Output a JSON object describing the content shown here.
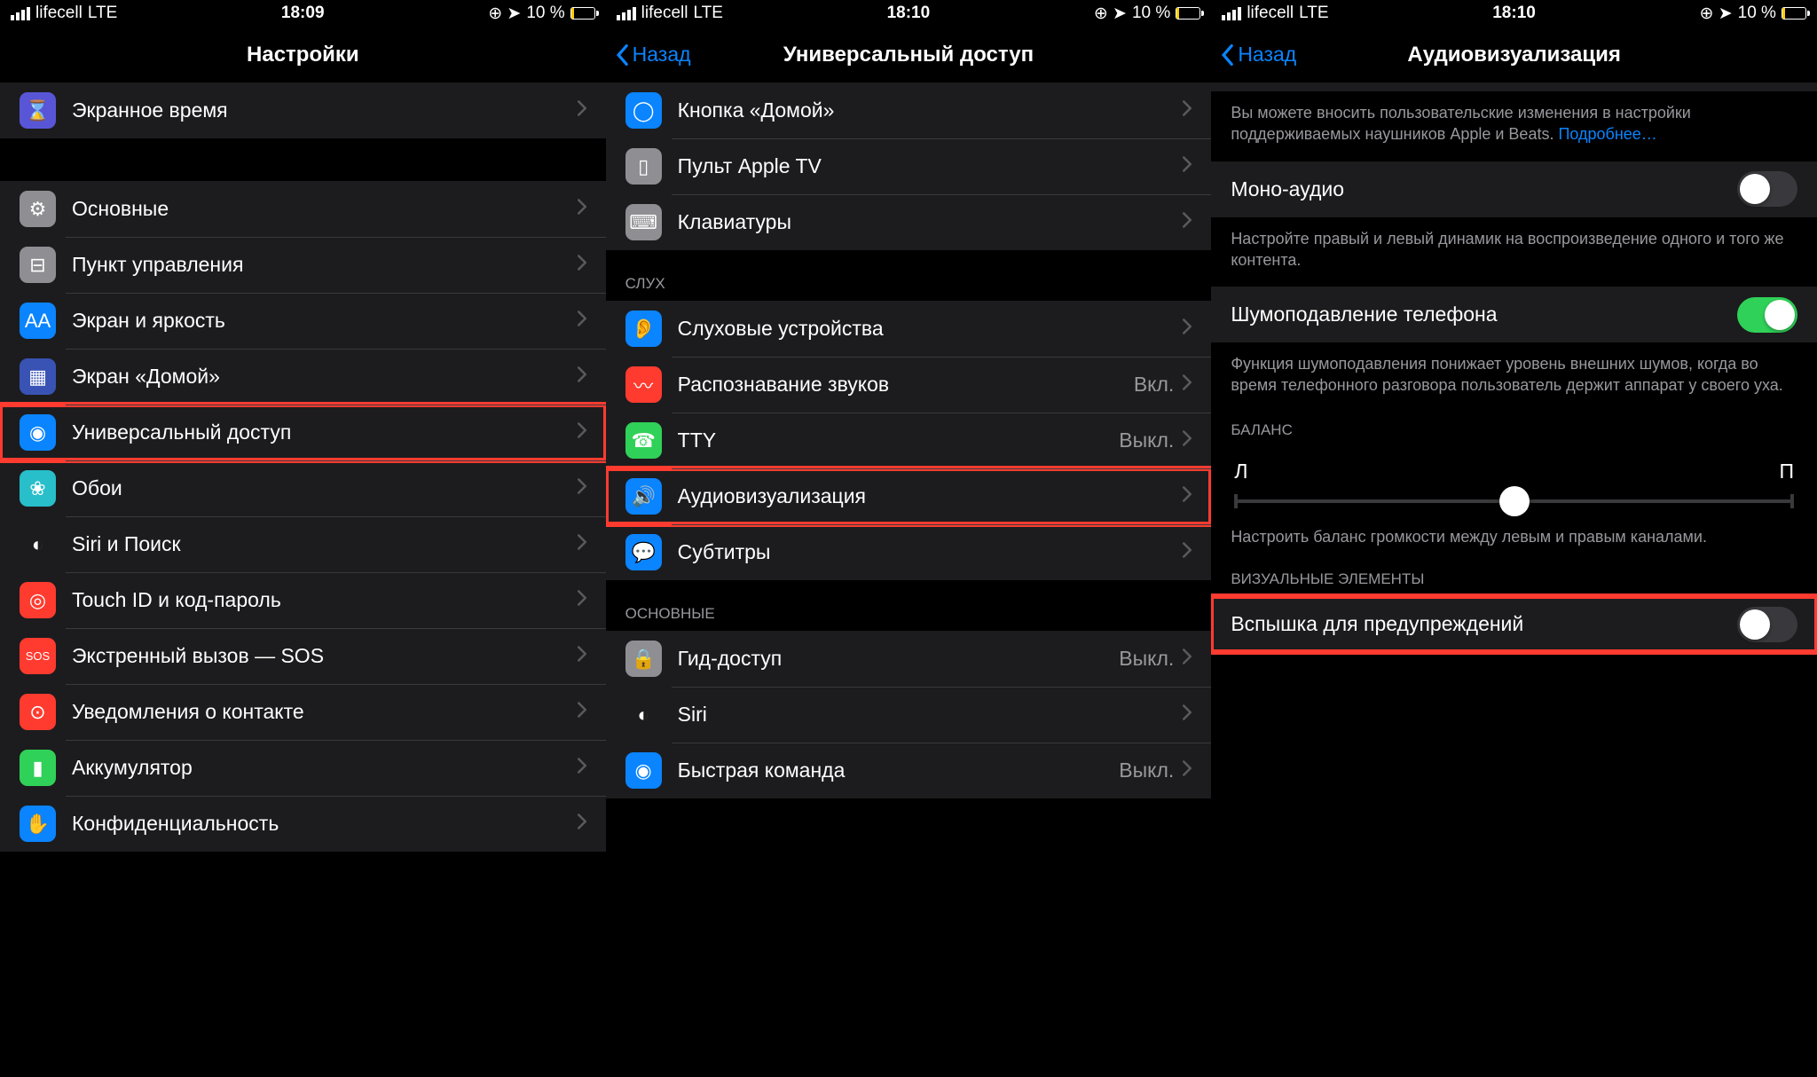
{
  "status": {
    "carrier": "lifecell",
    "net": "LTE",
    "time1": "18:09",
    "time2": "18:10",
    "time3": "18:10",
    "battery": "10 %"
  },
  "p1": {
    "title": "Настройки",
    "items": [
      {
        "label": "Экранное время",
        "color": "#5856d6",
        "glyph": "⌛"
      },
      {
        "label": "Основные",
        "color": "#8e8e93",
        "glyph": "⚙"
      },
      {
        "label": "Пункт управления",
        "color": "#8e8e93",
        "glyph": "⊟"
      },
      {
        "label": "Экран и яркость",
        "color": "#0a84ff",
        "glyph": "AA"
      },
      {
        "label": "Экран «Домой»",
        "color": "#3953b4",
        "glyph": "▦"
      },
      {
        "label": "Универсальный доступ",
        "color": "#0a84ff",
        "glyph": "◉",
        "hl": true
      },
      {
        "label": "Обои",
        "color": "#28beca",
        "glyph": "❀"
      },
      {
        "label": "Siri и Поиск",
        "color": "#1c1c1e",
        "glyph": "◐"
      },
      {
        "label": "Touch ID и код-пароль",
        "color": "#ff3b30",
        "glyph": "◎"
      },
      {
        "label": "Экстренный вызов — SOS",
        "color": "#ff3b30",
        "glyph": "SOS"
      },
      {
        "label": "Уведомления о контакте",
        "color": "#ff3b30",
        "glyph": "⊙"
      },
      {
        "label": "Аккумулятор",
        "color": "#30d158",
        "glyph": "▮"
      },
      {
        "label": "Конфиденциальность",
        "color": "#0a84ff",
        "glyph": "✋"
      }
    ]
  },
  "p2": {
    "back": "Назад",
    "title": "Универсальный доступ",
    "g1": [
      {
        "label": "Кнопка «Домой»",
        "color": "#0a84ff",
        "glyph": "◯"
      },
      {
        "label": "Пульт Apple TV",
        "color": "#8e8e93",
        "glyph": "▯"
      },
      {
        "label": "Клавиатуры",
        "color": "#8e8e93",
        "glyph": "⌨"
      }
    ],
    "h1": "СЛУХ",
    "g2": [
      {
        "label": "Слуховые устройства",
        "color": "#0a84ff",
        "glyph": "👂"
      },
      {
        "label": "Распознавание звуков",
        "color": "#ff3b30",
        "glyph": "〰",
        "value": "Вкл."
      },
      {
        "label": "TTY",
        "color": "#30d158",
        "glyph": "☎",
        "value": "Выкл."
      },
      {
        "label": "Аудиовизуализация",
        "color": "#0a84ff",
        "glyph": "🔊",
        "hl": true
      },
      {
        "label": "Субтитры",
        "color": "#0a84ff",
        "glyph": "💬"
      }
    ],
    "h2": "ОСНОВНЫЕ",
    "g3": [
      {
        "label": "Гид-доступ",
        "color": "#8e8e93",
        "glyph": "🔒",
        "value": "Выкл."
      },
      {
        "label": "Siri",
        "color": "#1c1c1e",
        "glyph": "◐"
      },
      {
        "label": "Быстрая команда",
        "color": "#0a84ff",
        "glyph": "◉",
        "value": "Выкл."
      }
    ]
  },
  "p3": {
    "back": "Назад",
    "title": "Аудиовизуализация",
    "desc1_a": "Вы можете вносить пользовательские изменения в настройки поддерживаемых наушников Apple и Beats. ",
    "desc1_link": "Подробнее…",
    "mono": "Моно-аудио",
    "desc2": "Настройте правый и левый динамик на воспроизведение одного и того же контента.",
    "noise": "Шумоподавление телефона",
    "desc3": "Функция шумоподавления понижает уровень внешних шумов, когда во время телефонного разговора пользователь держит аппарат у своего уха.",
    "balance_h": "БАЛАНС",
    "bal_l": "Л",
    "bal_r": "П",
    "desc4": "Настроить баланс громкости между левым и правым каналами.",
    "visual_h": "ВИЗУАЛЬНЫЕ ЭЛЕМЕНТЫ",
    "flash": "Вспышка для предупреждений"
  }
}
